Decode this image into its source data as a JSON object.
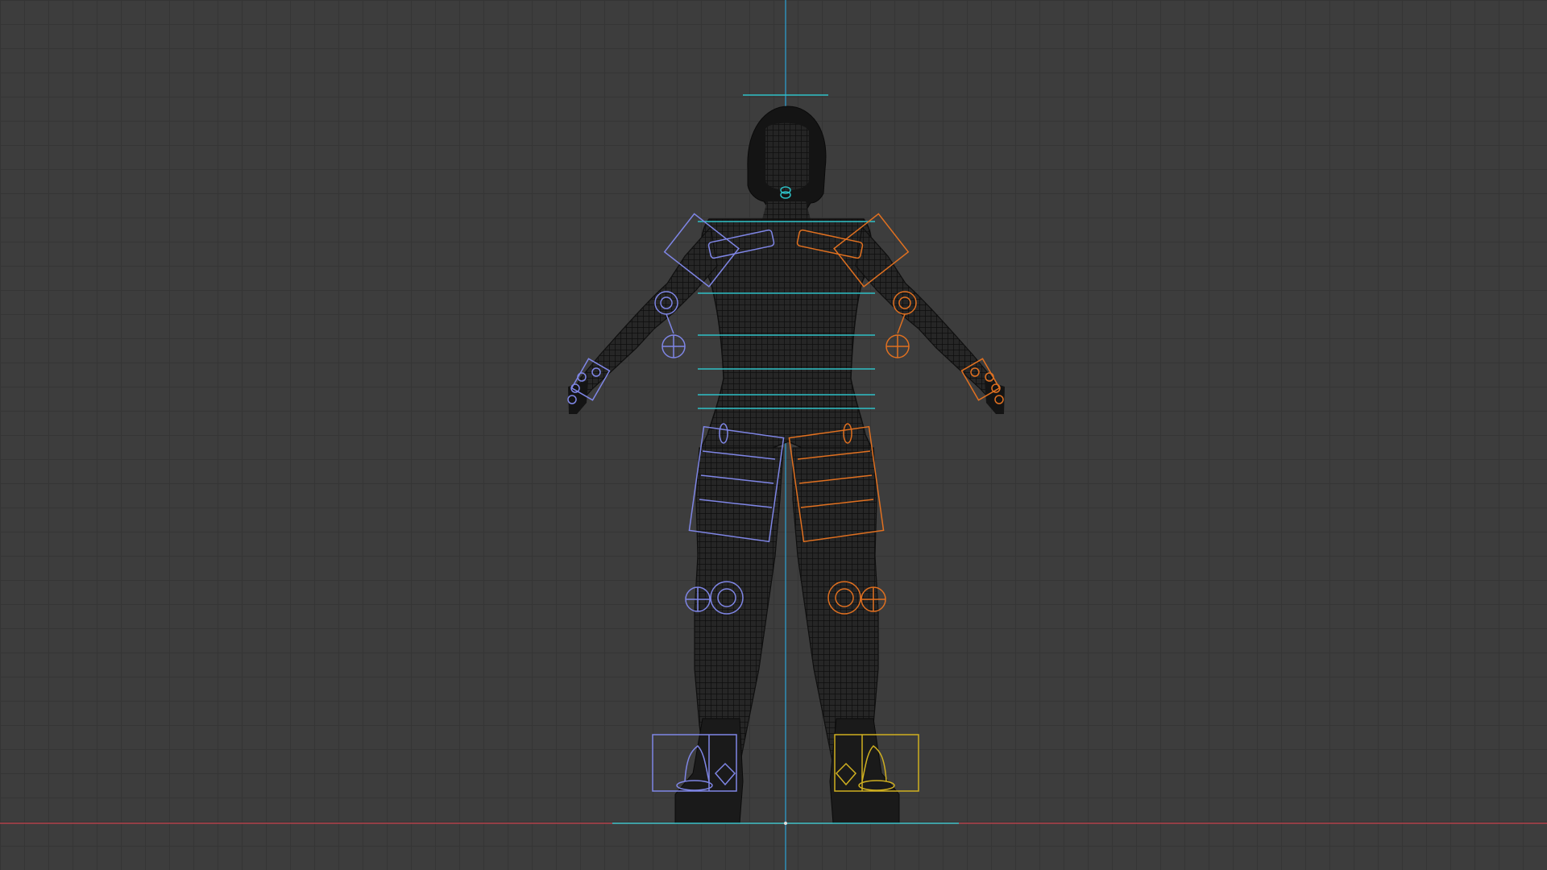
{
  "viewport": {
    "mode": "front-orthographic",
    "grid": true,
    "colors": {
      "background": "#3d3d3d",
      "grid_line": "#353535",
      "x_axis": "#b0404a",
      "z_axis": "#2e8fb8",
      "mesh_wire": "#141414",
      "left_controls": "#7f86e6",
      "right_controls": "#e07020",
      "center_controls": "#2ec0c6",
      "foot_right_controls": "#d0b020"
    }
  },
  "character": {
    "display": "wireframe",
    "pose": "A-pose"
  },
  "rig": {
    "control_groups": [
      "torso",
      "left-arm",
      "right-arm",
      "left-leg",
      "right-leg",
      "left-foot",
      "right-foot",
      "head"
    ]
  }
}
